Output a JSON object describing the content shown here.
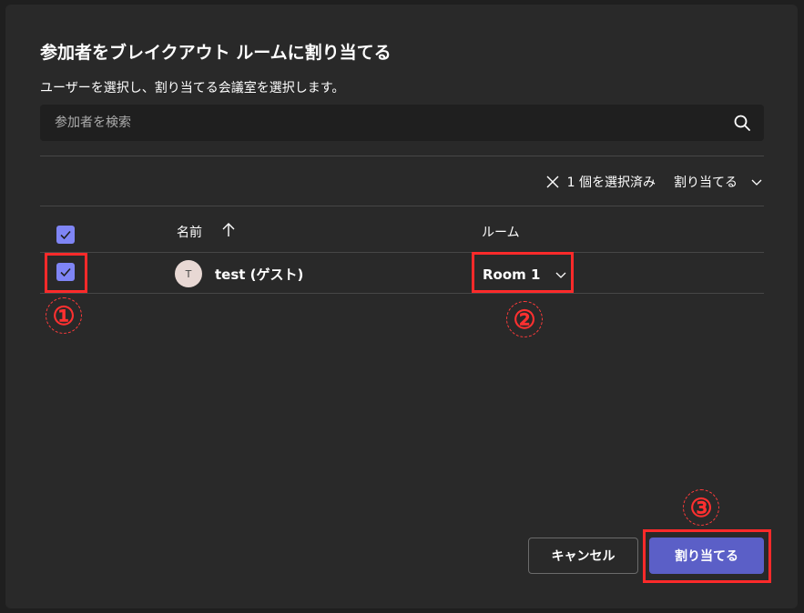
{
  "dialog": {
    "title": "参加者をブレイクアウト ルームに割り当てる",
    "subtitle": "ユーザーを選択し、割り当てる会議室を選択します。"
  },
  "search": {
    "placeholder": "参加者を検索",
    "value": "",
    "icon": "search-icon"
  },
  "toolbar": {
    "selection_count": "1 個を選択済み",
    "assign_label": "割り当てる",
    "clear_icon": "close-icon",
    "dropdown_icon": "chevron-down-icon"
  },
  "table": {
    "columns": [
      {
        "label": "名前",
        "sort": "ascending",
        "sort_icon": "arrow-up-icon"
      },
      {
        "label": "ルーム"
      }
    ],
    "header_checkbox_checked": true,
    "rows": [
      {
        "avatar_initial": "T",
        "name": "test (ゲスト)",
        "room": "Room 1",
        "checked": true
      }
    ]
  },
  "annotations": [
    "①",
    "②",
    "③"
  ],
  "annotation_color": "#ff2a2a",
  "buttons": {
    "cancel": "キャンセル",
    "assign": "割り当てる"
  },
  "colors": {
    "background": "#292929",
    "accent": "#5b5fc7",
    "checkbox": "#7f85f5"
  }
}
